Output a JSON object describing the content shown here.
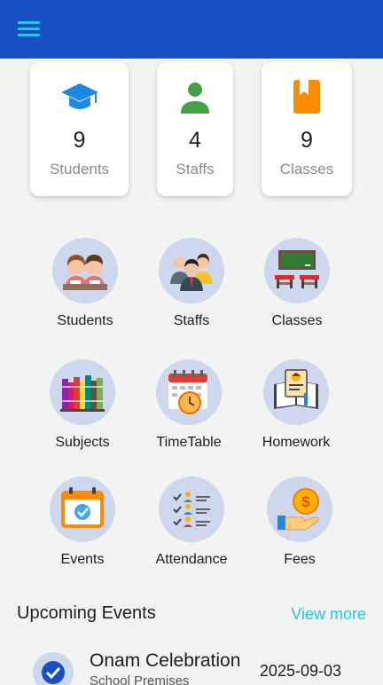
{
  "appbar": {
    "menu_icon": "hamburger-menu-icon",
    "bg_color": "#1a4fc4"
  },
  "stats": [
    {
      "value": "9",
      "label": "Students",
      "icon": "graduation-cap-icon",
      "color": "#1e88e5"
    },
    {
      "value": "4",
      "label": "Staffs",
      "icon": "person-icon",
      "color": "#43a047"
    },
    {
      "value": "9",
      "label": "Classes",
      "icon": "book-icon",
      "color": "#fb8c00"
    }
  ],
  "menu": [
    {
      "label": "Students",
      "icon": "students-icon"
    },
    {
      "label": "Staffs",
      "icon": "staff-group-icon"
    },
    {
      "label": "Classes",
      "icon": "classroom-icon"
    },
    {
      "label": "Subjects",
      "icon": "books-icon"
    },
    {
      "label": "TimeTable",
      "icon": "calendar-clock-icon"
    },
    {
      "label": "Homework",
      "icon": "homework-icon"
    },
    {
      "label": "Events",
      "icon": "event-calendar-icon"
    },
    {
      "label": "Attendance",
      "icon": "attendance-checklist-icon"
    },
    {
      "label": "Fees",
      "icon": "fees-coin-hand-icon"
    }
  ],
  "events_section": {
    "title": "Upcoming Events",
    "view_more": "View more",
    "items": [
      {
        "title": "Onam Celebration",
        "place": "School Premises",
        "date": "2025-09-03"
      }
    ]
  },
  "accent_color": "#26c6da"
}
